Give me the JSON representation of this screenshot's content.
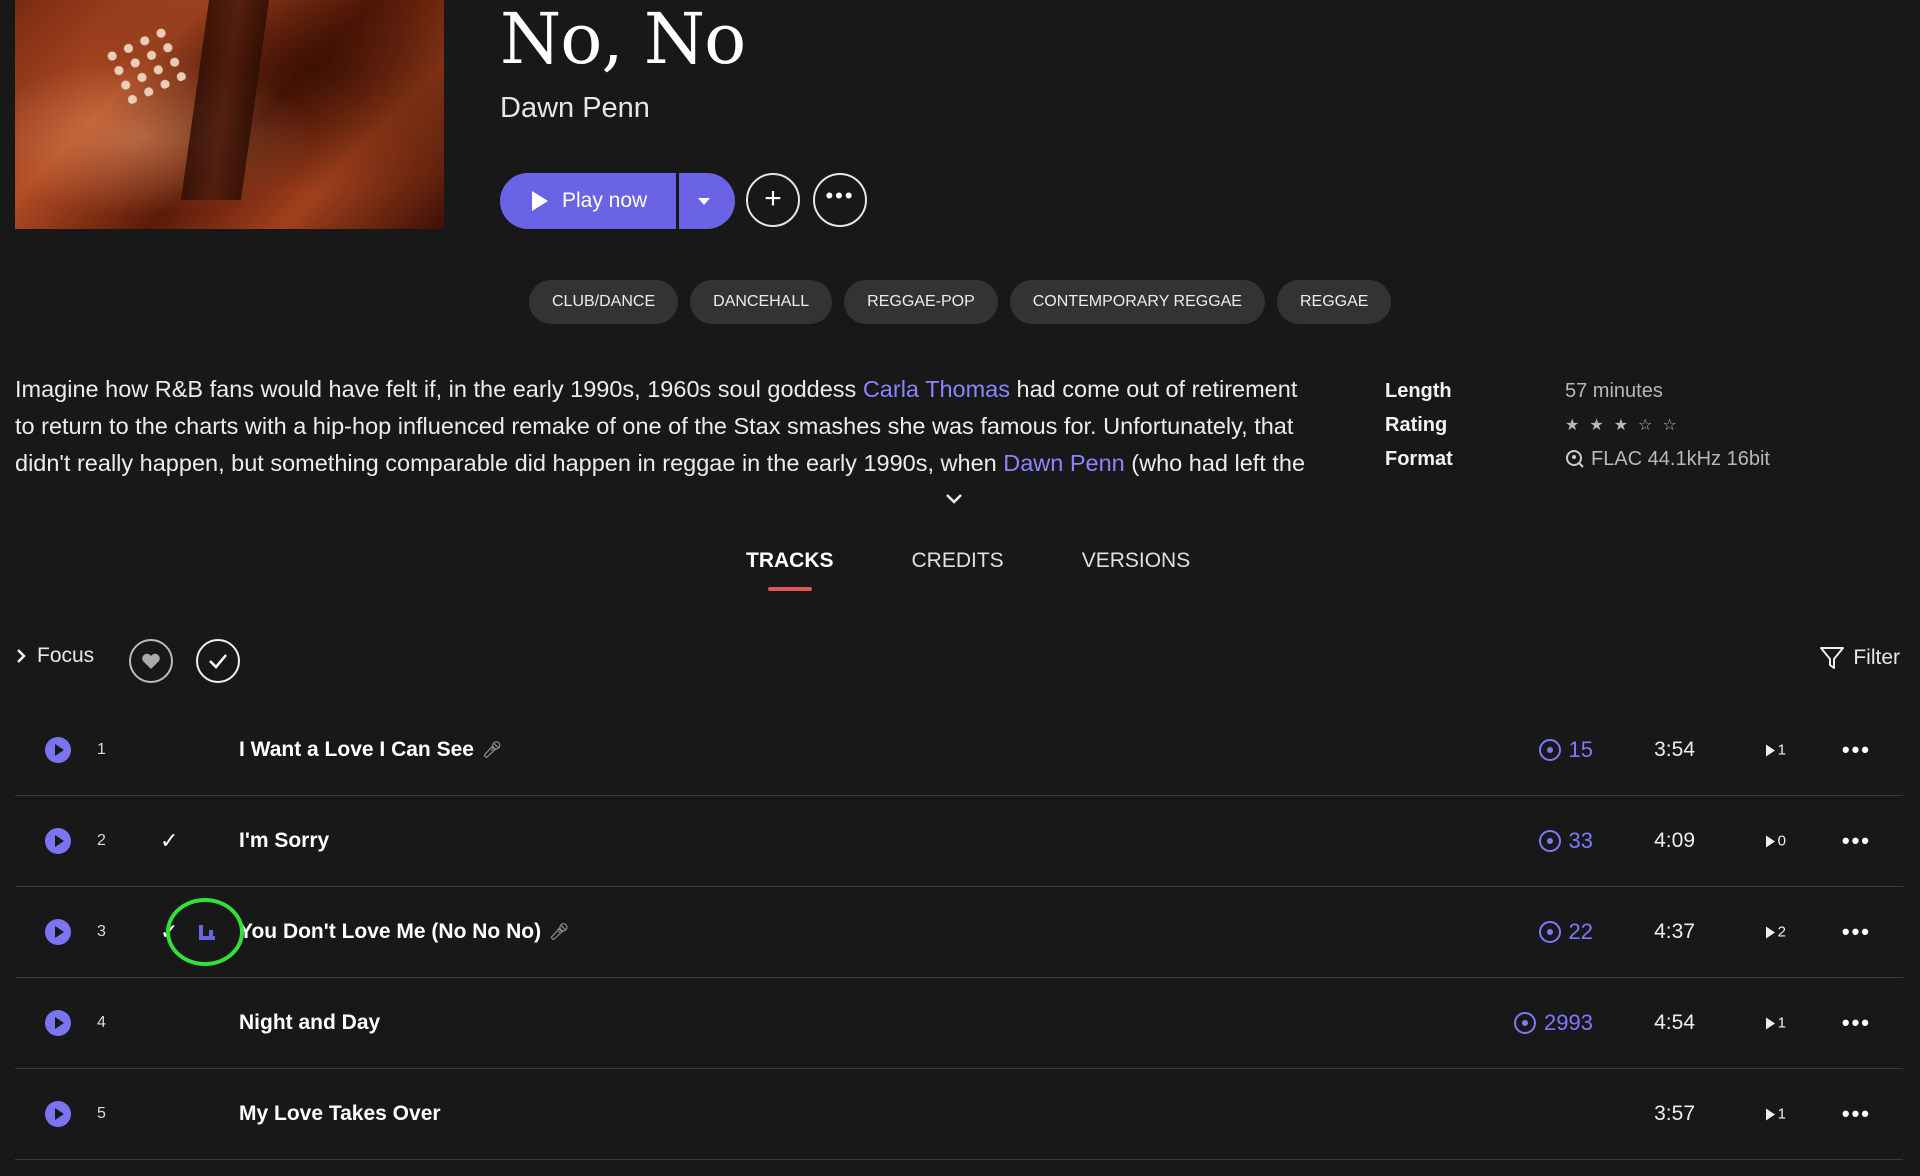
{
  "album": {
    "title": "No, No",
    "artist": "Dawn Penn"
  },
  "actions": {
    "play_label": "Play now"
  },
  "genres": [
    "CLUB/DANCE",
    "DANCEHALL",
    "REGGAE-POP",
    "CONTEMPORARY REGGAE",
    "REGGAE"
  ],
  "description": {
    "part1": "Imagine how R&B fans would have felt if, in the early 1990s, 1960s soul goddess ",
    "link1": "Carla Thomas",
    "part2": " had come out of retirement to return to the charts with a hip-hop influenced remake of one of the Stax smashes she was famous for. Unfortunately, that didn't really happen, but something comparable did happen in reggae in the early 1990s, when ",
    "link2": "Dawn Penn",
    "part3": " (who had left the"
  },
  "meta": {
    "length_label": "Length",
    "length_value": "57 minutes",
    "rating_label": "Rating",
    "rating_value": 3,
    "rating_max": 5,
    "format_label": "Format",
    "format_value": "FLAC 44.1kHz 16bit"
  },
  "tabs": [
    "TRACKS",
    "CREDITS",
    "VERSIONS"
  ],
  "toolbar": {
    "focus_label": "Focus",
    "filter_label": "Filter"
  },
  "colors": {
    "accent": "#6b63e6",
    "link": "#8b84ff",
    "highlight": "#33e03a",
    "tab_underline": "#e05555"
  },
  "tracks": [
    {
      "num": "1",
      "name": "I Want a Love I Can See",
      "checked": false,
      "mic": true,
      "plays": "15",
      "duration": "3:54",
      "count": "1"
    },
    {
      "num": "2",
      "name": "I'm Sorry",
      "checked": true,
      "mic": false,
      "plays": "33",
      "duration": "4:09",
      "count": "0"
    },
    {
      "num": "3",
      "name": "You Don't Love Me (No No No)",
      "checked": true,
      "mic": true,
      "plays": "22",
      "duration": "4:37",
      "count": "2"
    },
    {
      "num": "4",
      "name": "Night and Day",
      "checked": false,
      "mic": false,
      "plays": "2993",
      "duration": "4:54",
      "count": "1"
    },
    {
      "num": "5",
      "name": "My Love Takes Over",
      "checked": false,
      "mic": false,
      "plays": "",
      "duration": "3:57",
      "count": "1"
    }
  ]
}
